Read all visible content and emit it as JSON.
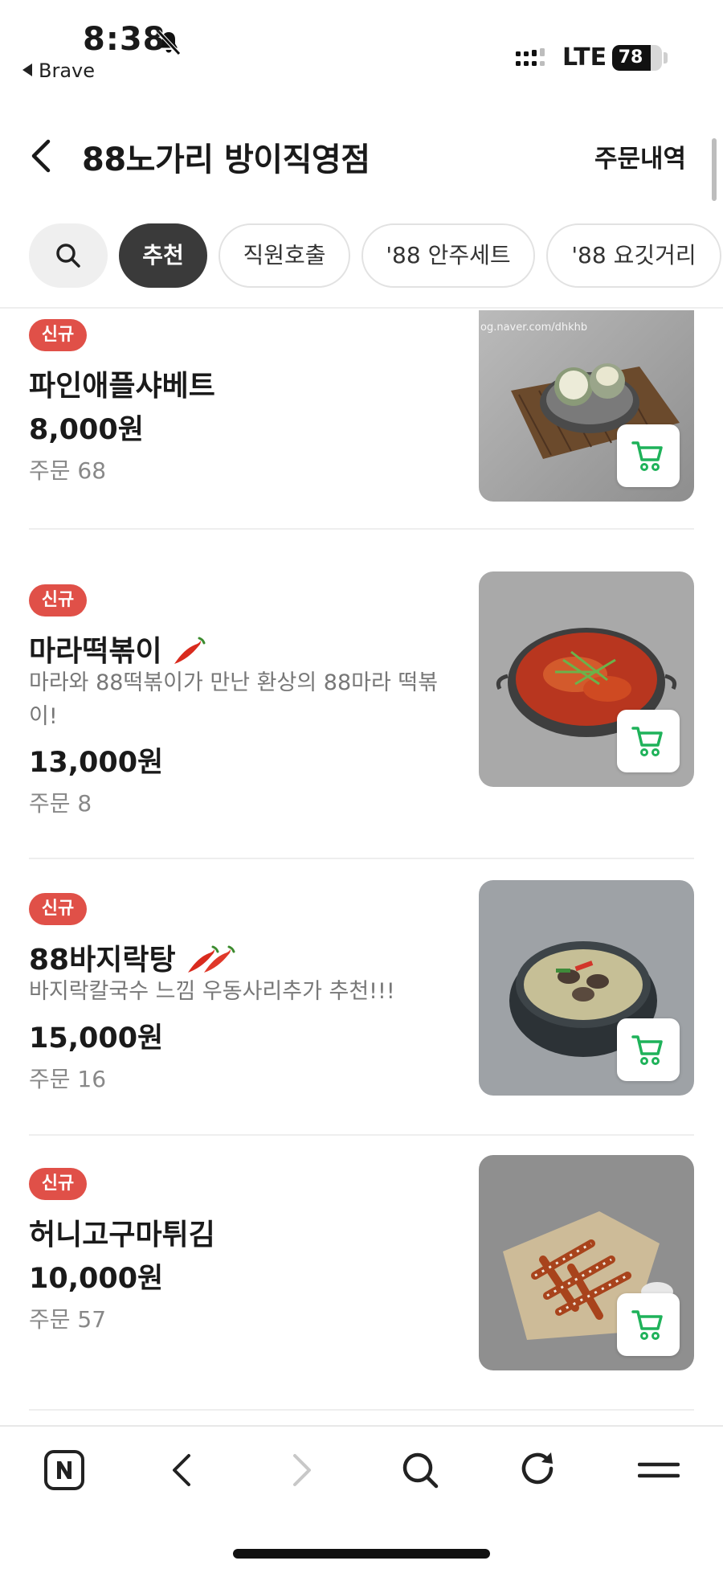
{
  "status": {
    "time": "8:38",
    "back_app": "Brave",
    "network": "LTE",
    "battery": "78",
    "battery_level": 0.78
  },
  "header": {
    "title": "88노가리 방이직영점",
    "orders_link": "주문내역"
  },
  "categories": [
    "추천",
    "직원호출",
    "'88 안주세트",
    "'88 요깃거리"
  ],
  "items": [
    {
      "badge": "신규",
      "name": "파인애플샤베트",
      "desc": "",
      "price": "8,000원",
      "orders": "주문 68",
      "spicy": 0,
      "photo_watermark": "og.naver.com/dhkhb"
    },
    {
      "badge": "신규",
      "name": "마라떡볶이",
      "desc": "마라와 88떡볶이가 만난 환상의 88마라 떡볶이!",
      "price": "13,000원",
      "orders": "주문 8",
      "spicy": 1
    },
    {
      "badge": "신규",
      "name": "88바지락탕",
      "desc": "바지락칼국수 느낌 우동사리추가 추천!!!",
      "price": "15,000원",
      "orders": "주문 16",
      "spicy": 2
    },
    {
      "badge": "신규",
      "name": "허니고구마튀김",
      "desc": "",
      "price": "10,000원",
      "orders": "주문 57",
      "spicy": 0
    }
  ],
  "colors": {
    "badge": "#e05048",
    "cart_icon": "#1fb25a",
    "active_tab": "#3a3a3a"
  }
}
